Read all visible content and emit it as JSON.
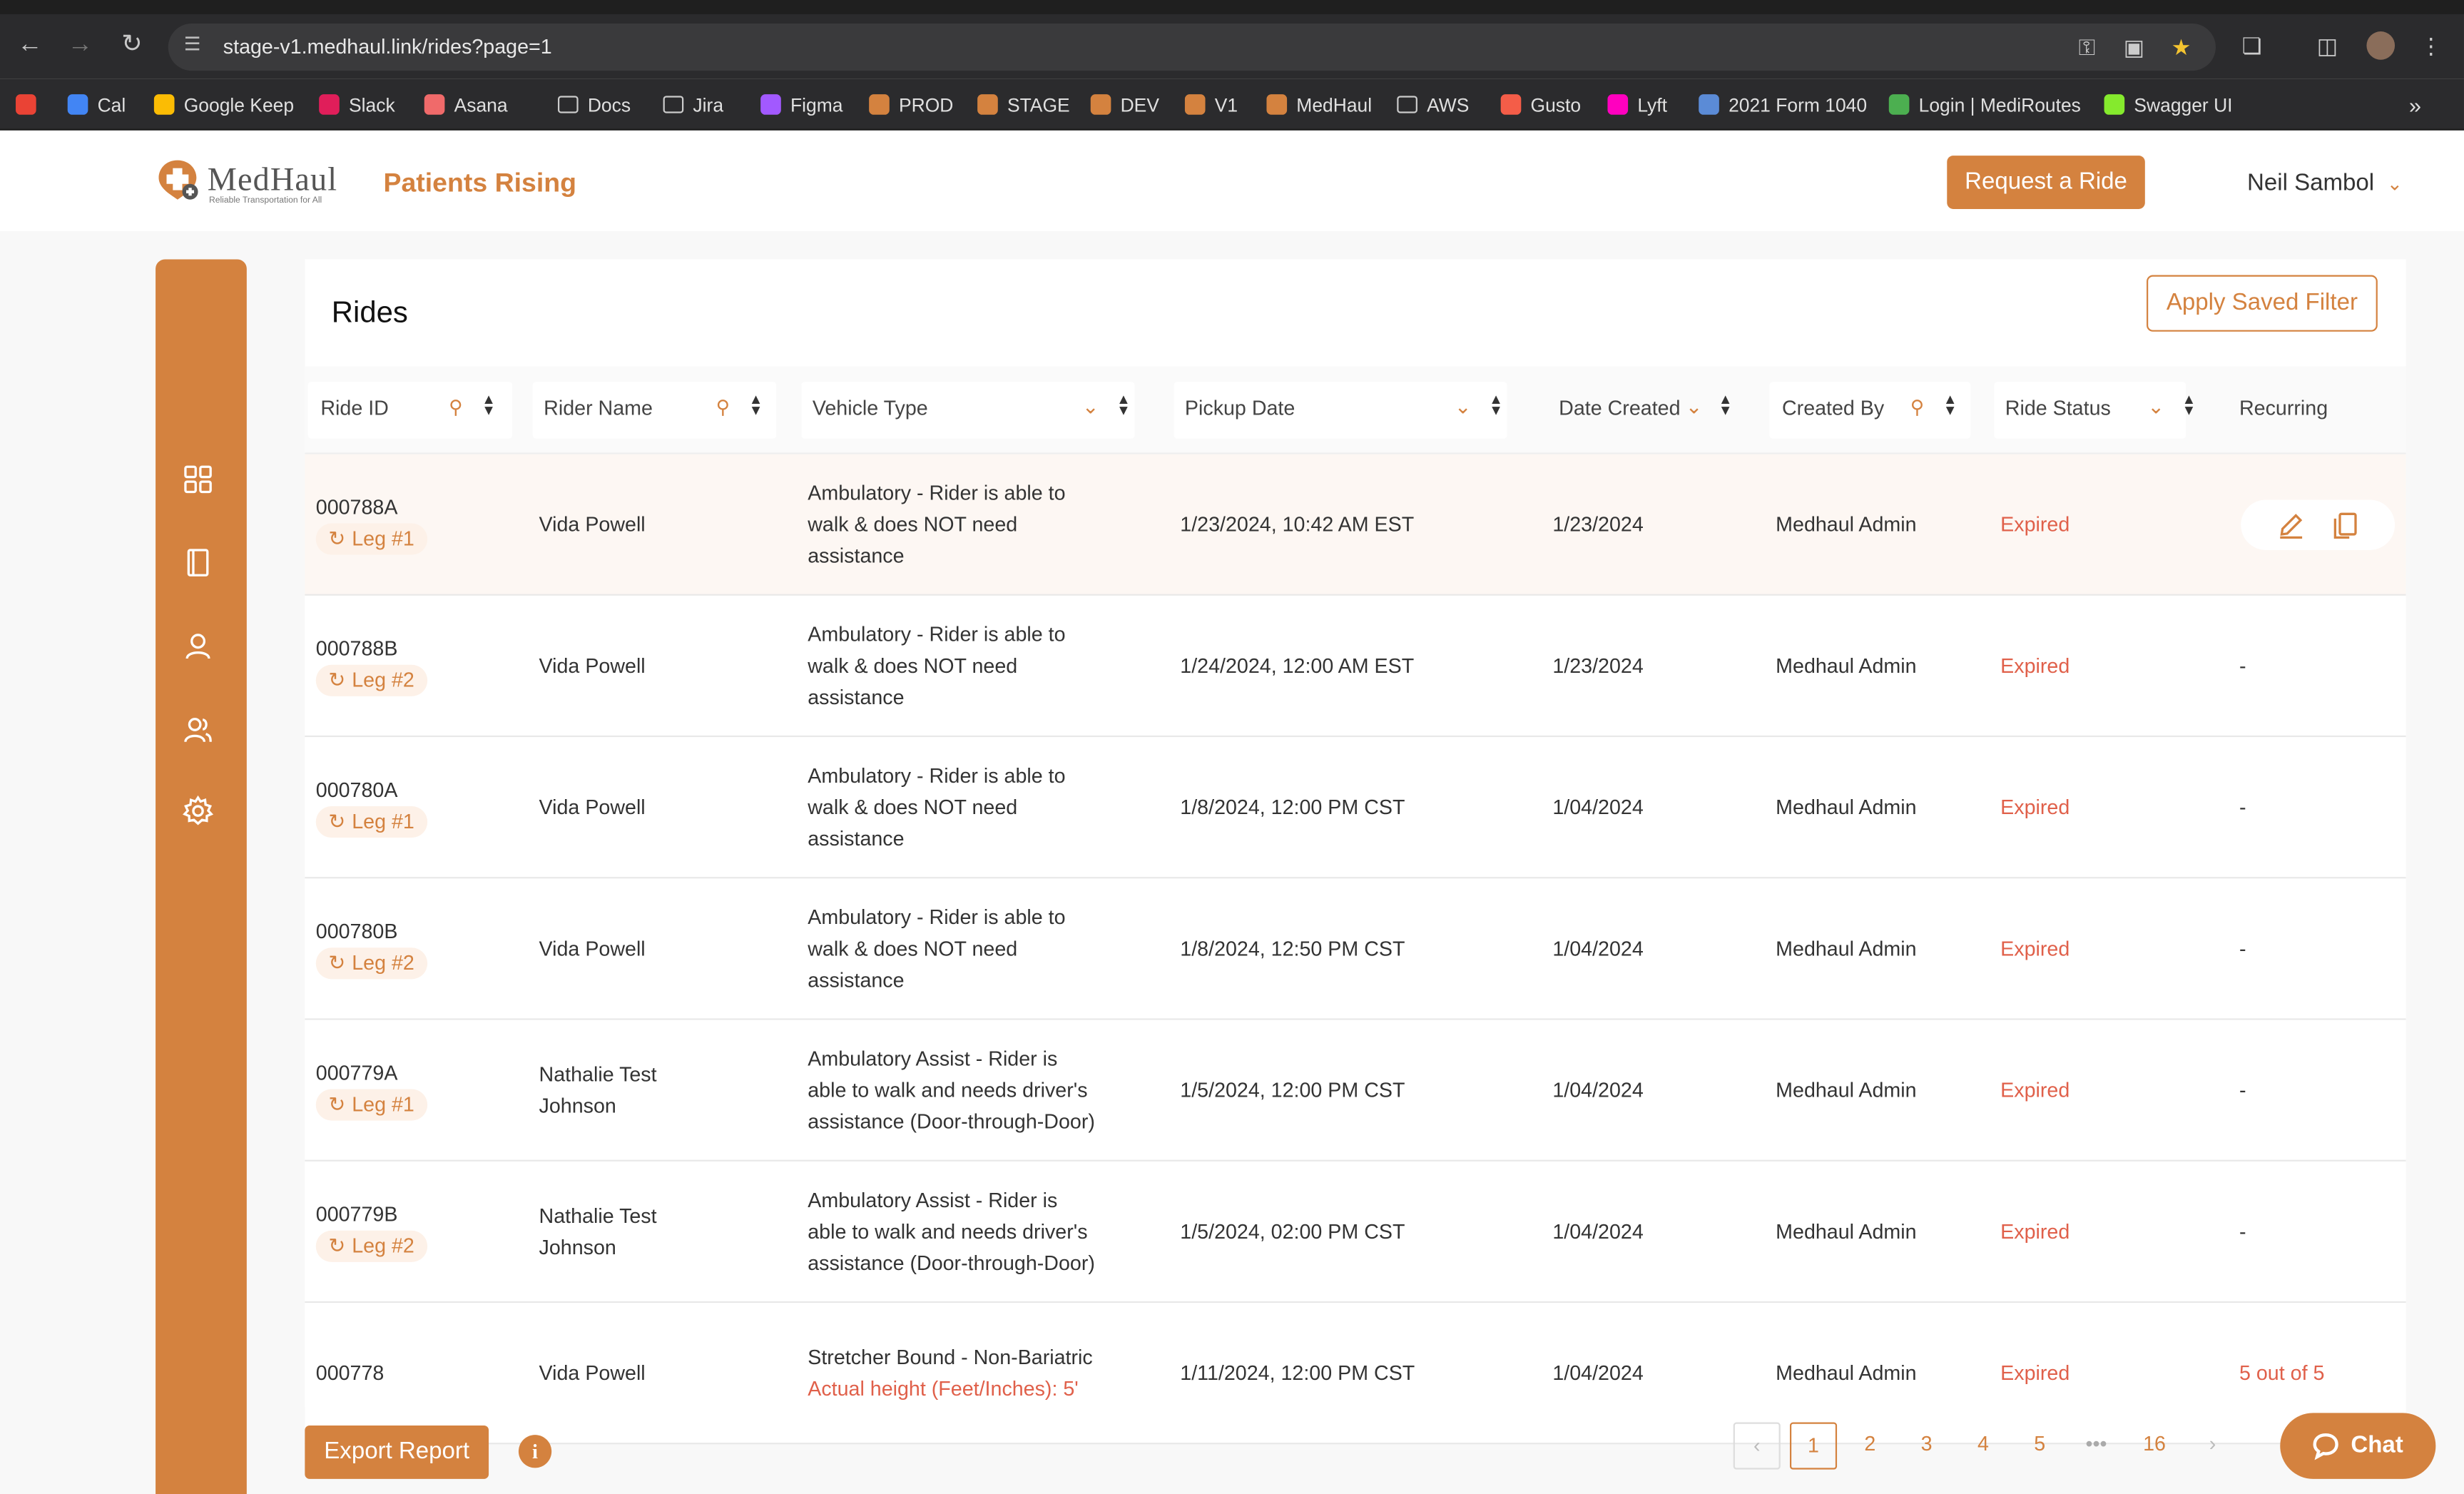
{
  "browser": {
    "url": "stage-v1.medhaul.link/rides?page=1",
    "bookmarks": [
      {
        "label": "",
        "color": "#ea4335"
      },
      {
        "label": "Cal",
        "color": "#4285f4"
      },
      {
        "label": "Google Keep",
        "color": "#fbbc04"
      },
      {
        "label": "Slack",
        "color": "#e01e5a"
      },
      {
        "label": "Asana",
        "color": "#f06a6a"
      },
      {
        "label": "Docs",
        "color": "folder"
      },
      {
        "label": "Jira",
        "color": "folder"
      },
      {
        "label": "Figma",
        "color": "#a259ff"
      },
      {
        "label": "PROD",
        "color": "#d4823f"
      },
      {
        "label": "STAGE",
        "color": "#d4823f"
      },
      {
        "label": "DEV",
        "color": "#d4823f"
      },
      {
        "label": "V1",
        "color": "#d4823f"
      },
      {
        "label": "MedHaul",
        "color": "#d4823f"
      },
      {
        "label": "AWS",
        "color": "folder"
      },
      {
        "label": "Gusto",
        "color": "#f45d48"
      },
      {
        "label": "Lyft",
        "color": "#ff00bf"
      },
      {
        "label": "2021 Form 1040",
        "color": "#5b8bd6"
      },
      {
        "label": "Login | MediRoutes",
        "color": "#4caf50"
      },
      {
        "label": "Swagger UI",
        "color": "#85ea2d"
      }
    ]
  },
  "header": {
    "brand": "MedHaul",
    "tagline": "Reliable Transportation for All",
    "org": "Patients Rising",
    "request_label": "Request a Ride",
    "user_name": "Neil Sambol"
  },
  "page": {
    "title": "Rides",
    "saved_filter_label": "Apply Saved Filter"
  },
  "table": {
    "columns": [
      "Ride ID",
      "Rider Name",
      "Vehicle Type",
      "Pickup Date",
      "Date Created",
      "Created By",
      "Ride Status",
      "Recurring"
    ],
    "rows": [
      {
        "id": "000788A",
        "leg": "Leg #1",
        "rider": [
          "Vida Powell"
        ],
        "vehicle": [
          "Ambulatory - Rider is able to",
          "walk & does NOT need",
          "assistance"
        ],
        "pickup": "1/23/2024, 10:42 AM EST",
        "created": "1/23/2024",
        "by": "Medhaul Admin",
        "status": "Expired",
        "recurring": ""
      },
      {
        "id": "000788B",
        "leg": "Leg #2",
        "rider": [
          "Vida Powell"
        ],
        "vehicle": [
          "Ambulatory - Rider is able to",
          "walk & does NOT need",
          "assistance"
        ],
        "pickup": "1/24/2024, 12:00 AM EST",
        "created": "1/23/2024",
        "by": "Medhaul Admin",
        "status": "Expired",
        "recurring": "-"
      },
      {
        "id": "000780A",
        "leg": "Leg #1",
        "rider": [
          "Vida Powell"
        ],
        "vehicle": [
          "Ambulatory - Rider is able to",
          "walk & does NOT need",
          "assistance"
        ],
        "pickup": "1/8/2024, 12:00 PM CST",
        "created": "1/04/2024",
        "by": "Medhaul Admin",
        "status": "Expired",
        "recurring": "-"
      },
      {
        "id": "000780B",
        "leg": "Leg #2",
        "rider": [
          "Vida Powell"
        ],
        "vehicle": [
          "Ambulatory - Rider is able to",
          "walk & does NOT need",
          "assistance"
        ],
        "pickup": "1/8/2024, 12:50 PM CST",
        "created": "1/04/2024",
        "by": "Medhaul Admin",
        "status": "Expired",
        "recurring": "-"
      },
      {
        "id": "000779A",
        "leg": "Leg #1",
        "rider": [
          "Nathalie Test",
          "Johnson"
        ],
        "vehicle": [
          "Ambulatory Assist - Rider is",
          "able to walk and needs driver's",
          "assistance (Door-through-Door)"
        ],
        "pickup": "1/5/2024, 12:00 PM CST",
        "created": "1/04/2024",
        "by": "Medhaul Admin",
        "status": "Expired",
        "recurring": "-"
      },
      {
        "id": "000779B",
        "leg": "Leg #2",
        "rider": [
          "Nathalie Test",
          "Johnson"
        ],
        "vehicle": [
          "Ambulatory Assist - Rider is",
          "able to walk and needs driver's",
          "assistance (Door-through-Door)"
        ],
        "pickup": "1/5/2024, 02:00 PM CST",
        "created": "1/04/2024",
        "by": "Medhaul Admin",
        "status": "Expired",
        "recurring": "-"
      },
      {
        "id": "000778",
        "leg": "",
        "rider": [
          "Vida Powell"
        ],
        "vehicle": [
          "Stretcher Bound - Non-Bariatric"
        ],
        "vehicle_note": "Actual height (Feet/Inches): 5'",
        "pickup": "1/11/2024, 12:00 PM CST",
        "created": "1/04/2024",
        "by": "Medhaul Admin",
        "status": "Expired",
        "recurring": "5 out of 5"
      }
    ]
  },
  "footer": {
    "export_label": "Export Report",
    "info_label": "i",
    "pages": [
      "1",
      "2",
      "3",
      "4",
      "5",
      "•••",
      "16"
    ],
    "prev": "‹",
    "next": "›",
    "chat_label": "Chat"
  },
  "colors": {
    "accent": "#d4823f",
    "status_expired": "#e0604a"
  }
}
